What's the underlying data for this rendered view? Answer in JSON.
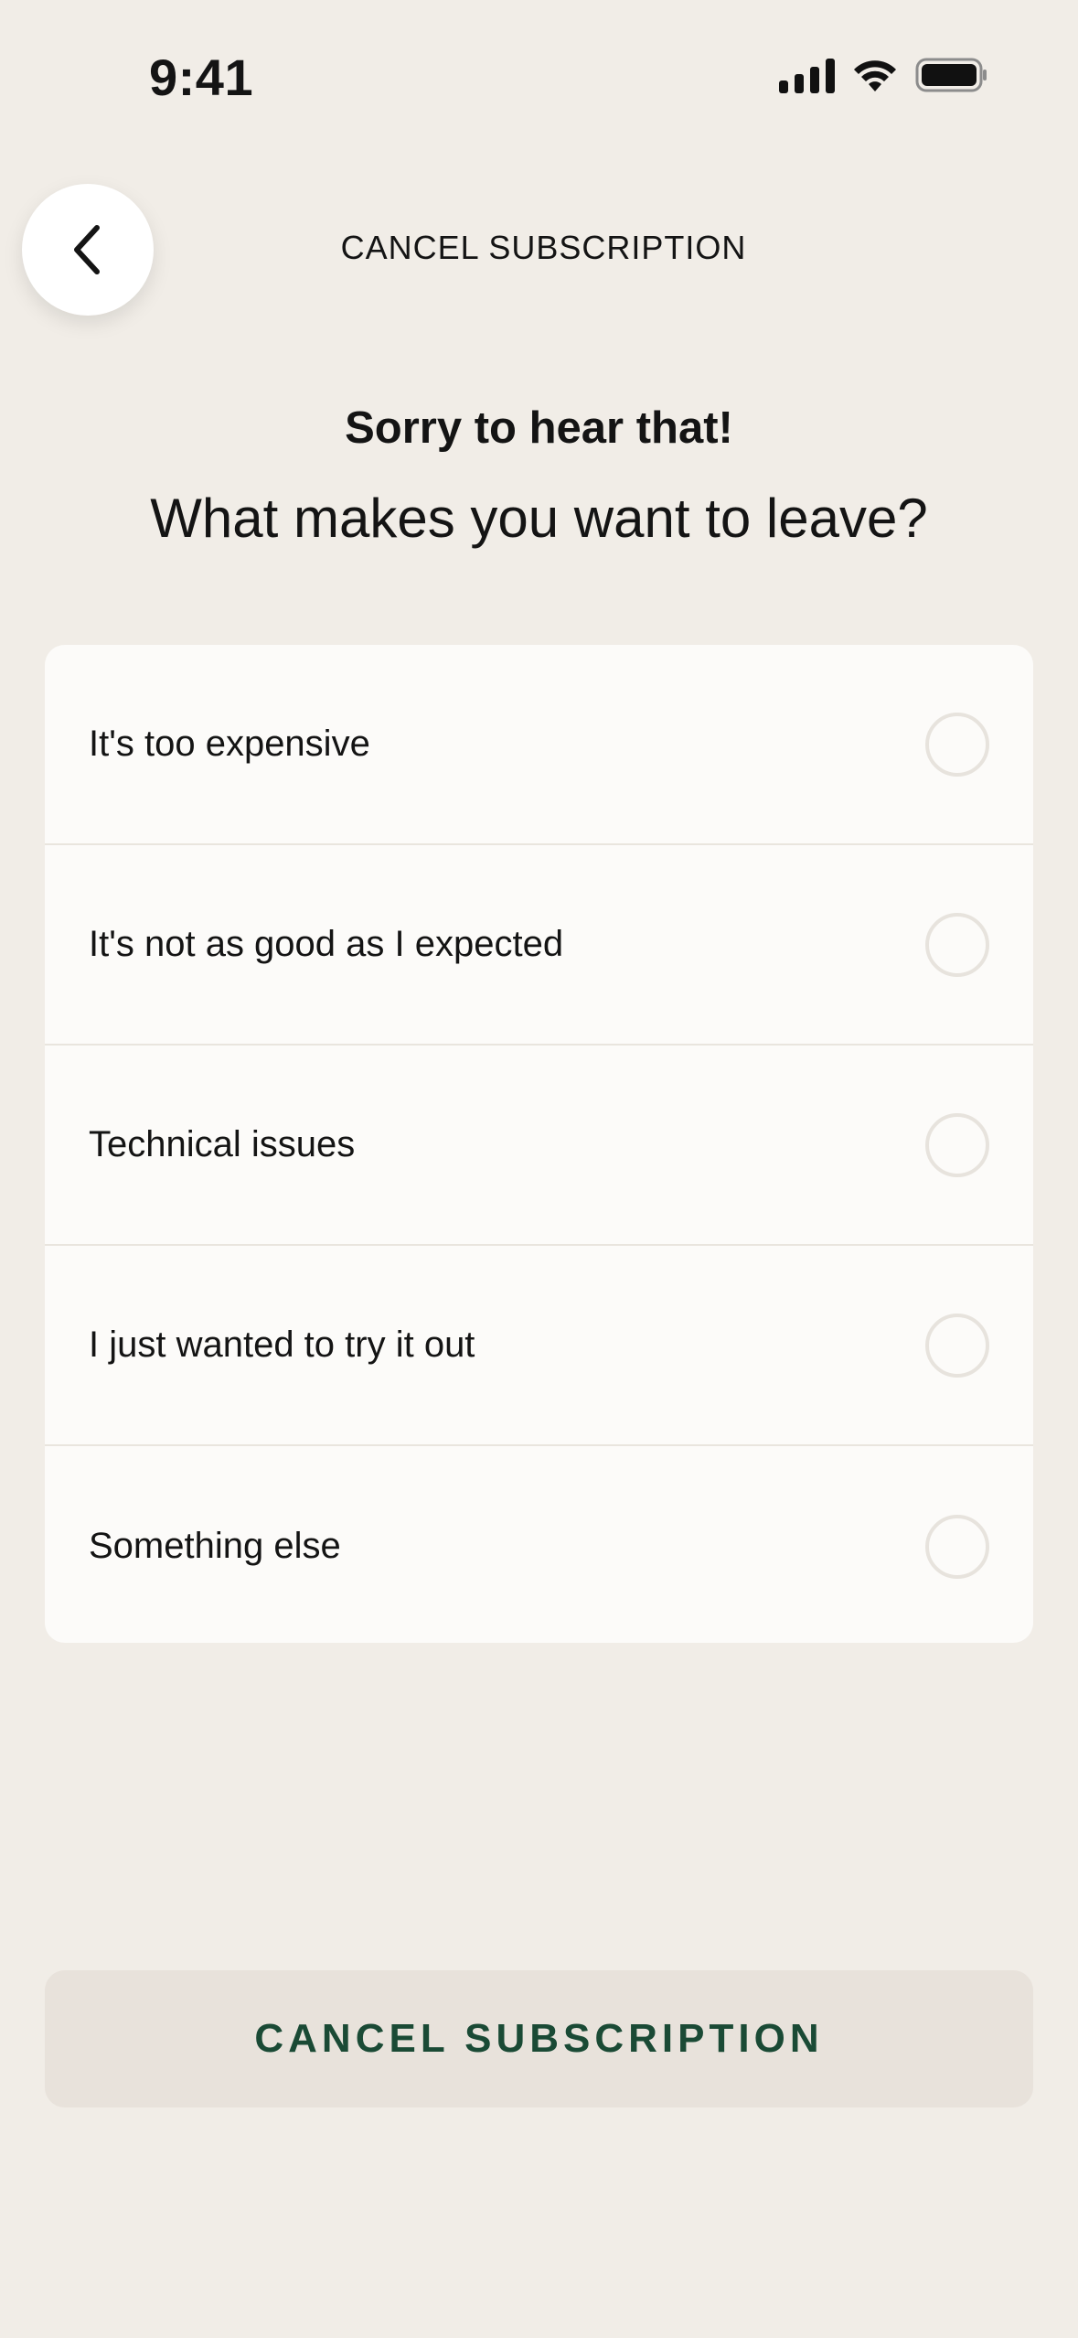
{
  "status_bar": {
    "time": "9:41"
  },
  "header": {
    "back_icon": "chevron-left-icon",
    "title": "CANCEL SUBSCRIPTION"
  },
  "content": {
    "subtitle": "Sorry to hear that!",
    "question": "What makes you want to leave?"
  },
  "options": [
    {
      "label": "It's too expensive"
    },
    {
      "label": "It's not as good as I expected"
    },
    {
      "label": "Technical issues"
    },
    {
      "label": "I just wanted to try it out"
    },
    {
      "label": "Something else"
    }
  ],
  "footer": {
    "button_label": "CANCEL SUBSCRIPTION"
  },
  "colors": {
    "background": "#F1EDE7",
    "card": "#FCFBF9",
    "button_bg": "#E8E2DB",
    "button_text": "#1A4A35",
    "radio_border": "#E7E3DD"
  }
}
